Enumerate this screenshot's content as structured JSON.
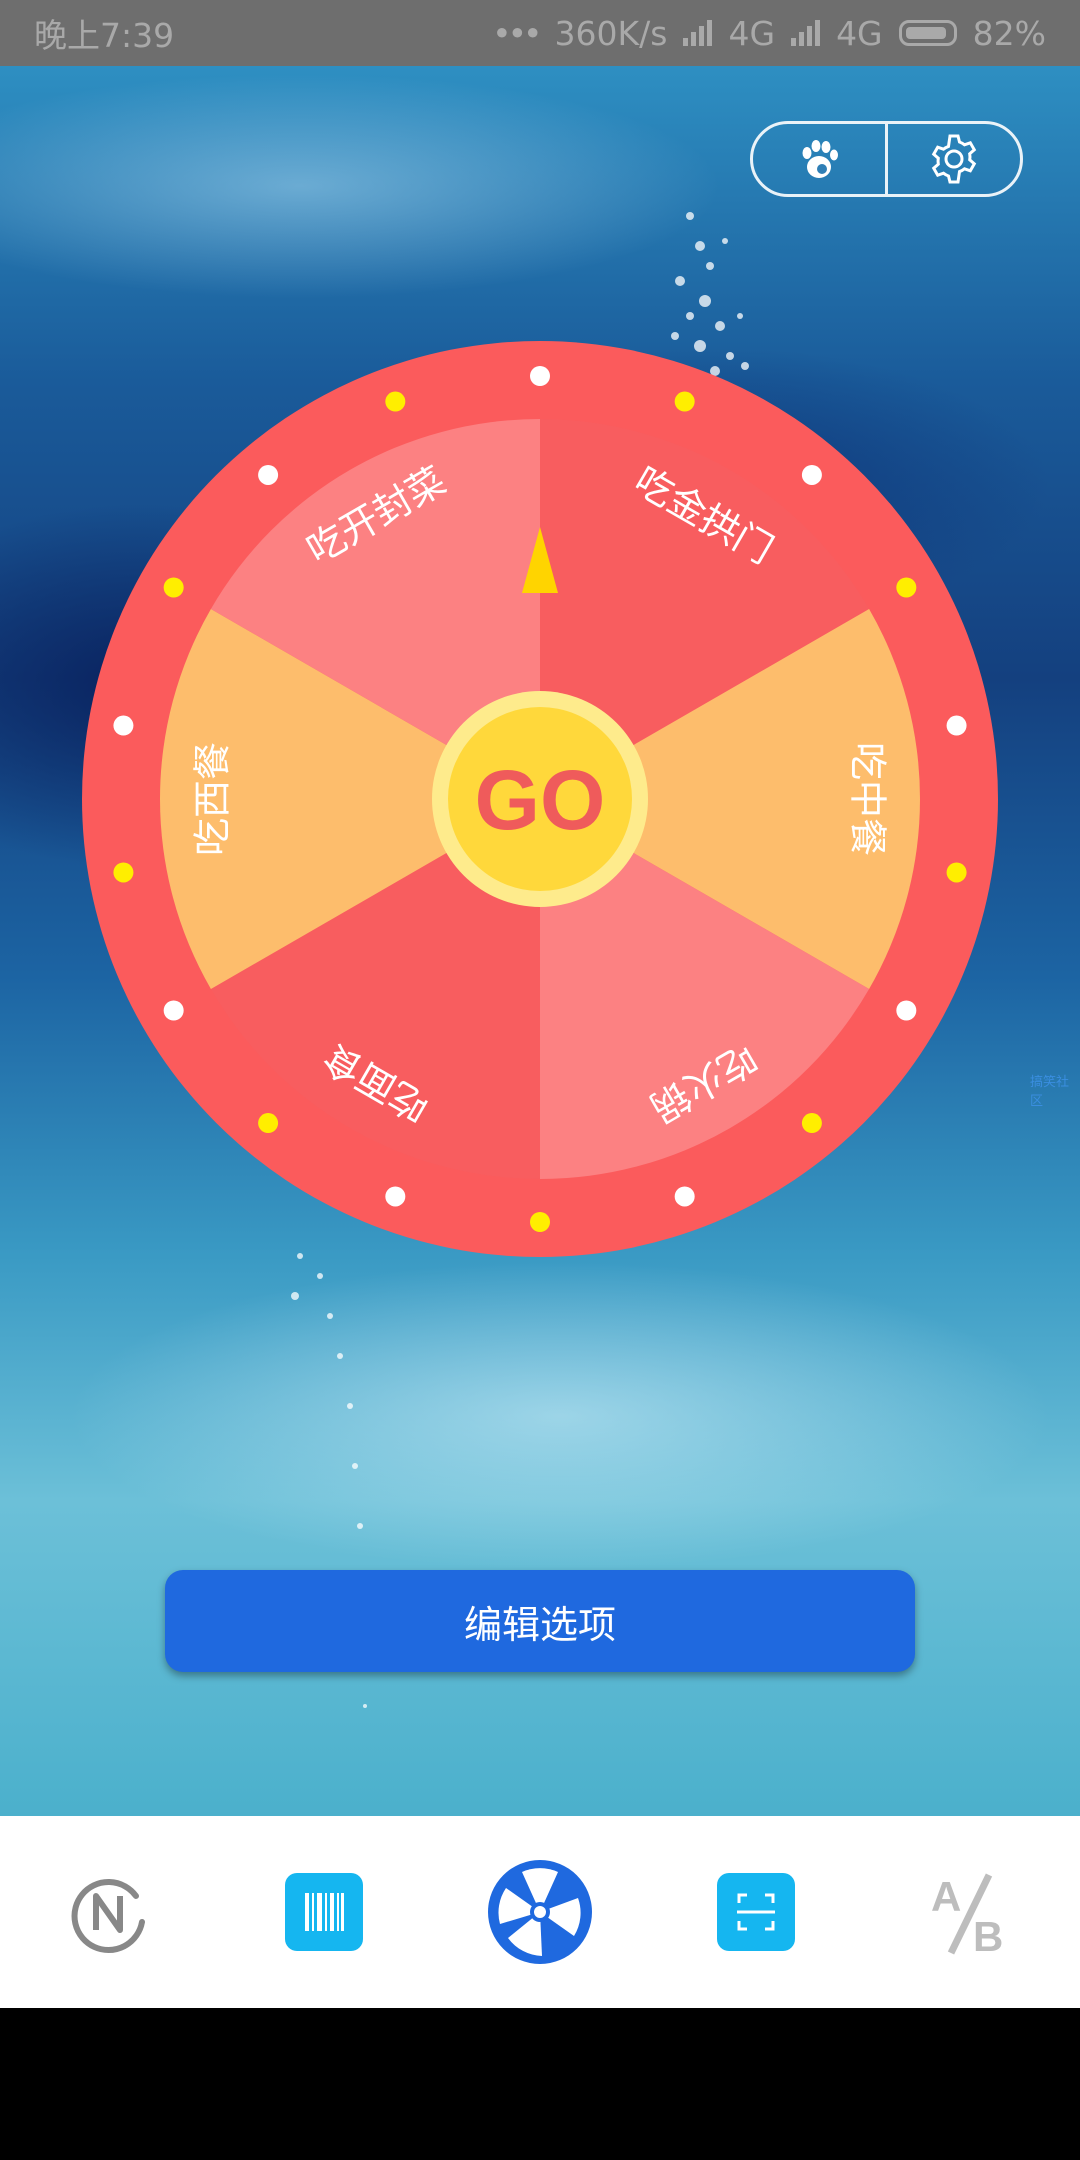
{
  "status_bar": {
    "time": "晚上7:39",
    "dots": "•••",
    "speed": "360K/s",
    "net1": "4G",
    "net2": "4G",
    "battery": "82%"
  },
  "wheel": {
    "center_label": "GO",
    "segments": [
      "吃金拱门",
      "吃中餐",
      "吃火锅",
      "吃面食",
      "吃西餐",
      "吃开封菜"
    ],
    "colors": {
      "rim": "#fb5b5c",
      "segment_a": "#f85d5f",
      "segment_b": "#fc8182",
      "segment_c": "#fdbd6c",
      "hub": "#ffd83b",
      "hub_ring": "#feeb8c",
      "dot_white": "#ffffff",
      "dot_yellow": "#ffee00"
    }
  },
  "edit_button": {
    "label": "编辑选项"
  },
  "side_tag": "搞笑社区",
  "bottom_nav": {
    "items": [
      "n-logo-icon",
      "barcode-icon",
      "wheel-icon",
      "scan-icon",
      "ab-icon"
    ],
    "accent": "#15b6f0"
  }
}
